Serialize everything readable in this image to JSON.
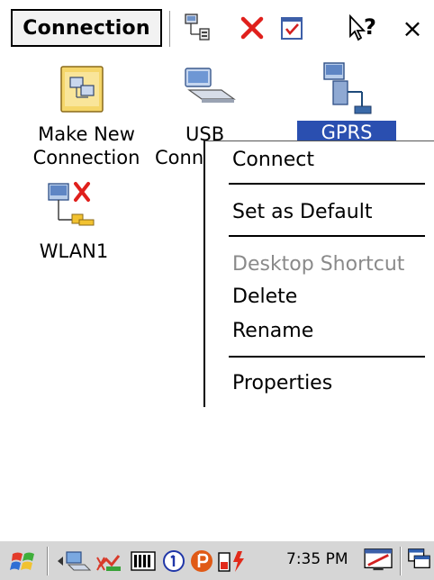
{
  "window": {
    "title": "Connection"
  },
  "toolbar": {
    "icons": [
      "network-properties-icon",
      "delete-icon",
      "properties-check-icon",
      "help-icon",
      "close-icon"
    ],
    "close_label": "×",
    "help_label": "?"
  },
  "items": [
    {
      "line1": "Make New",
      "line2": "Connection",
      "icon": "make-new-connection-icon"
    },
    {
      "line1": "USB",
      "line2": "Conn",
      "icon": "usb-connection-icon"
    },
    {
      "line1": "GPRS",
      "line2": "",
      "icon": "gprs-connection-icon",
      "selected": true
    },
    {
      "line1": "WLAN1",
      "line2": "",
      "icon": "wlan-connection-icon"
    }
  ],
  "context_menu": {
    "items": [
      {
        "label": "Connect",
        "disabled": false
      },
      {
        "label": "Set as Default",
        "disabled": false
      },
      {
        "label": "Desktop Shortcut",
        "disabled": true
      },
      {
        "label": "Delete",
        "disabled": false
      },
      {
        "label": "Rename",
        "disabled": false
      },
      {
        "label": "Properties",
        "disabled": false
      }
    ]
  },
  "taskbar": {
    "clock": "7:35 PM",
    "tray_icons": [
      "start-icon",
      "network-tray-icon",
      "bluetooth-tray-icon",
      "battery-tray-icon",
      "info-tray-icon",
      "power-tray-icon",
      "charging-tray-icon",
      "desktop-icon",
      "switch-window-icon"
    ]
  },
  "colors": {
    "selection": "#2a4fb0",
    "taskbar": "#d6d6d6",
    "delete_red": "#e0201c"
  }
}
